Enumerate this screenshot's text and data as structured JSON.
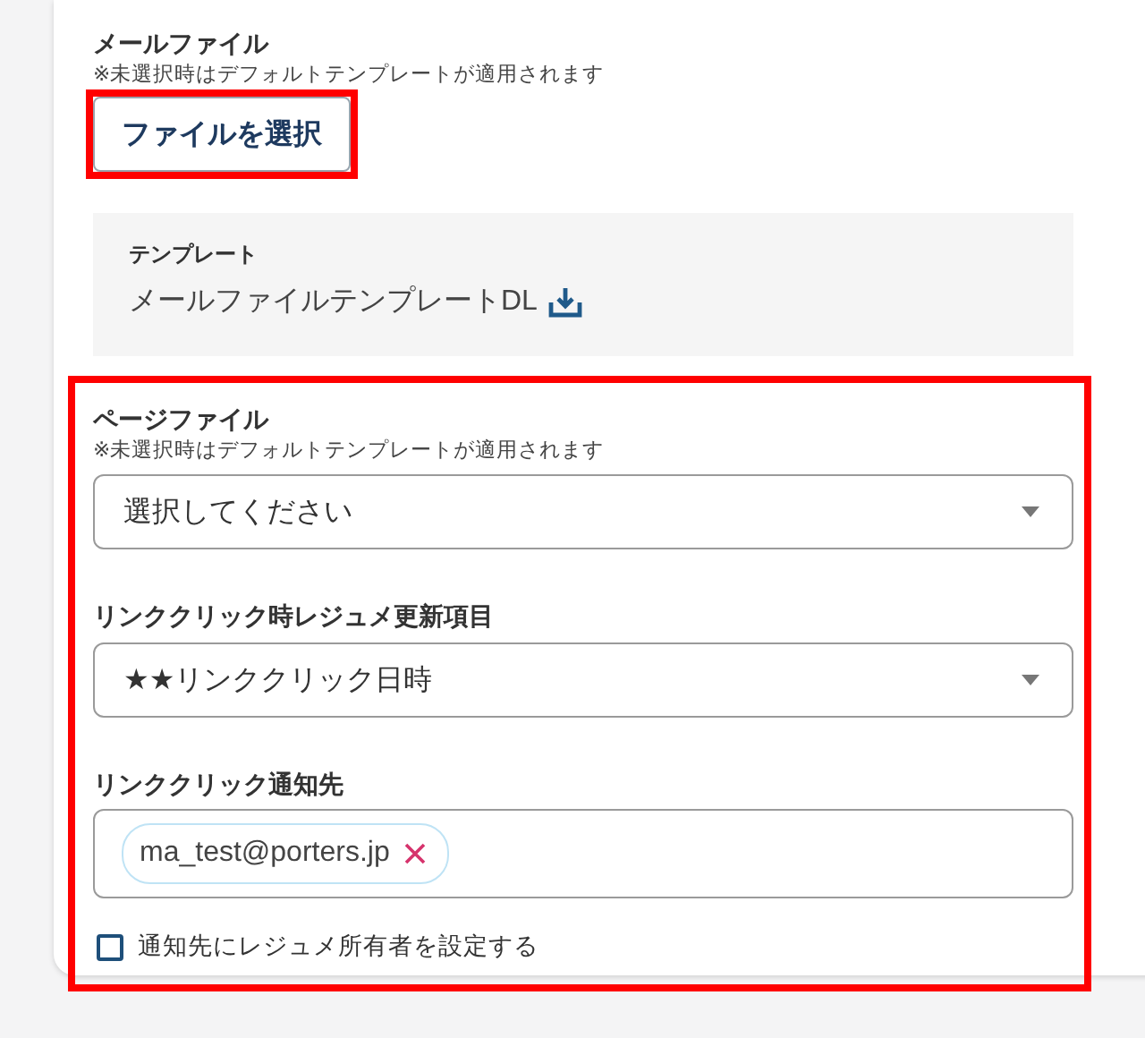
{
  "mail_file": {
    "label": "メールファイル",
    "note": "※未選択時はデフォルトテンプレートが適用されます",
    "button": "ファイルを選択",
    "highlighted": true
  },
  "template": {
    "label": "テンプレート",
    "link": "メールファイルテンプレートDL"
  },
  "link_settings": {
    "highlighted": true,
    "fields": [
      {
        "kind": "select",
        "label": "ページファイル",
        "note": "※未選択時はデフォルトテンプレートが適用されます",
        "value": "選択してください"
      },
      {
        "kind": "select",
        "label": "リンククリック時レジュメ更新項目",
        "value": "★★リンククリック日時"
      },
      {
        "kind": "tags",
        "label": "リンククリック通知先",
        "tags": [
          {
            "text": "ma_test@porters.jp"
          }
        ]
      },
      {
        "kind": "checkbox",
        "label": "通知先にレジュメ所有者を設定する",
        "checked": false
      }
    ]
  }
}
